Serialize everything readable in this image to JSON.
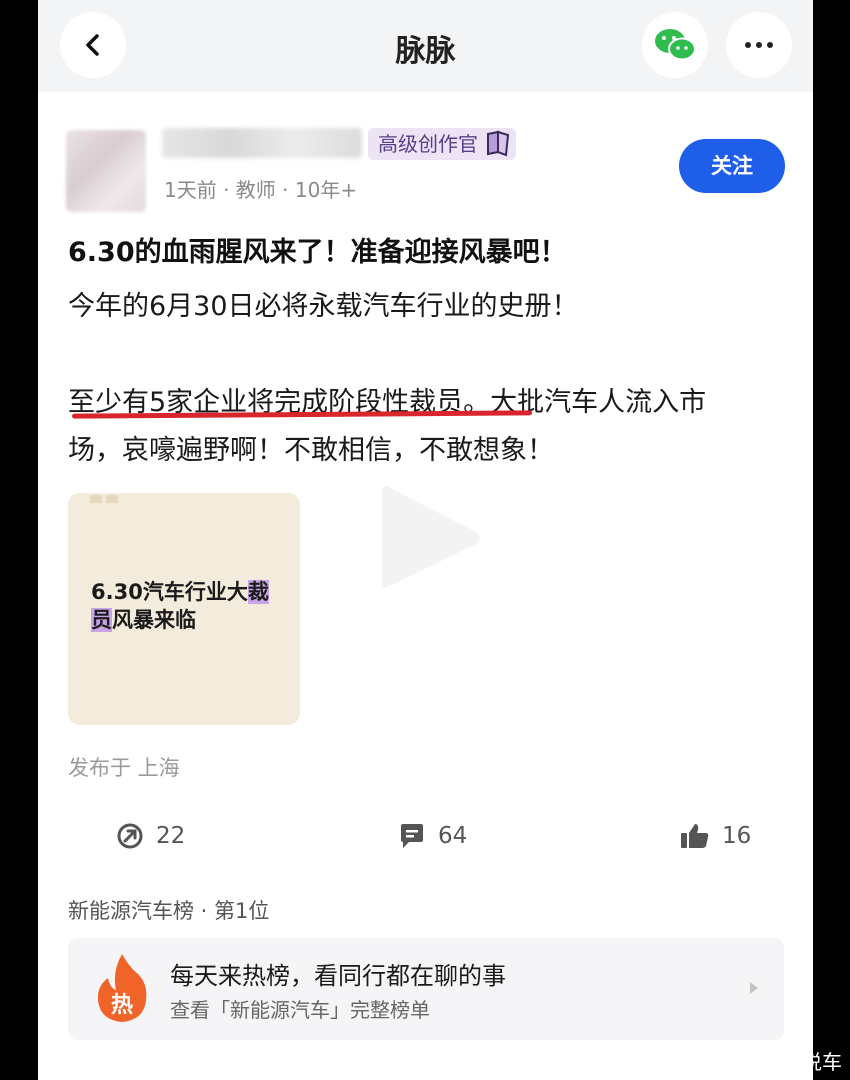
{
  "nav": {
    "title": "脉脉"
  },
  "author": {
    "badge": "高级创作官",
    "meta": "1天前 · 教师 · 10年+",
    "follow_label": "关注"
  },
  "post": {
    "title": "6.30的血雨腥风来了！准备迎接风暴吧！",
    "paragraph1": "今年的6月30日必将永载汽车行业的史册！",
    "paragraph2_line1": "至少有5家企业将完成阶段性裁员。大批汽车人流入市",
    "paragraph2_line2": "场，哀嚎遍野啊！不敢相信，不敢想象！",
    "thumbnail_line1_a": "6.30汽车行业大",
    "thumbnail_line1_b": "裁",
    "thumbnail_line2_a": "员",
    "thumbnail_line2_b": "风暴来临",
    "location": "发布于 上海"
  },
  "actions": {
    "share_count": "22",
    "comment_count": "64",
    "like_count": "16"
  },
  "ranking": {
    "label": "新能源汽车榜 · 第1位",
    "card_icon_text": "热",
    "card_title": "每天来热榜，看同行都在聊的事",
    "card_subtitle": "查看「新能源汽车」完整榜单"
  },
  "watermark": {
    "text": "@南哥说车"
  },
  "colors": {
    "accent": "#1f5ee8",
    "underline": "#d9262c",
    "badge_bg": "#ece4f5",
    "hot": "#f0642a"
  }
}
